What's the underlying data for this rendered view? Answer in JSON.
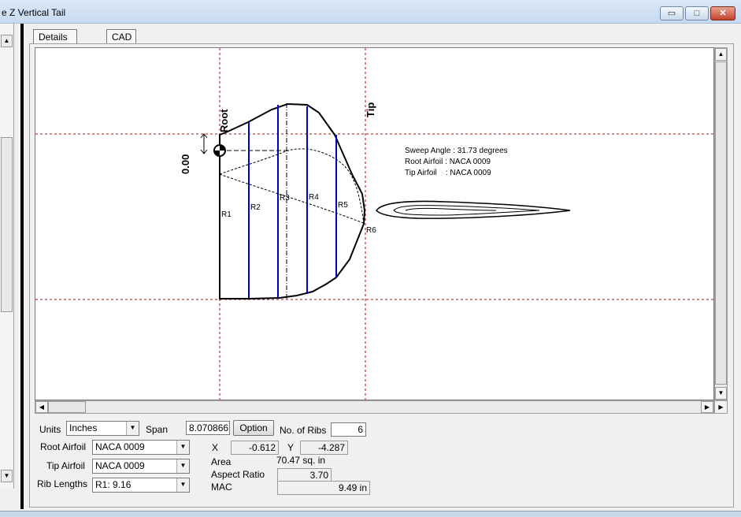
{
  "window": {
    "title": "e Z Vertical Tail",
    "min_glyph": "▭",
    "max_glyph": "□",
    "close_glyph": "✕"
  },
  "tabs": [
    {
      "label": "Details"
    },
    {
      "label": "CAD"
    }
  ],
  "drawing": {
    "root_label": "Root",
    "tip_label": "Tip",
    "offset_value": "0.00",
    "info_lines": [
      "Sweep Angle : 31.73 degrees",
      "Root Airfoil : NACA 0009",
      "Tip Airfoil    : NACA 0009"
    ],
    "rib_labels": [
      "R1",
      "R2",
      "R3",
      "R4",
      "R5",
      "R6"
    ],
    "colors": {
      "grid": "#c00000",
      "rib": "#0000c0",
      "outline": "#000000"
    }
  },
  "controls": {
    "units_label": "Units",
    "units_value": "Inches",
    "span_label": "Span",
    "span_value": "8.070866",
    "option_button": "Option",
    "num_ribs_label": "No. of Ribs",
    "num_ribs_value": "6",
    "root_airfoil_label": "Root Airfoil",
    "root_airfoil_value": "NACA 0009",
    "tip_airfoil_label": "Tip Airfoil",
    "tip_airfoil_value": "NACA 0009",
    "rib_lengths_label": "Rib Lengths",
    "rib_lengths_value": "R1: 9.16",
    "x_label": "X",
    "x_value": "-0.612",
    "y_label": "Y",
    "y_value": "-4.287",
    "area_label": "Area",
    "area_value": "70.47 sq. in",
    "aspect_label": "Aspect Ratio",
    "aspect_value": "3.70",
    "mac_label": "MAC",
    "mac_value": "9.49 in"
  }
}
